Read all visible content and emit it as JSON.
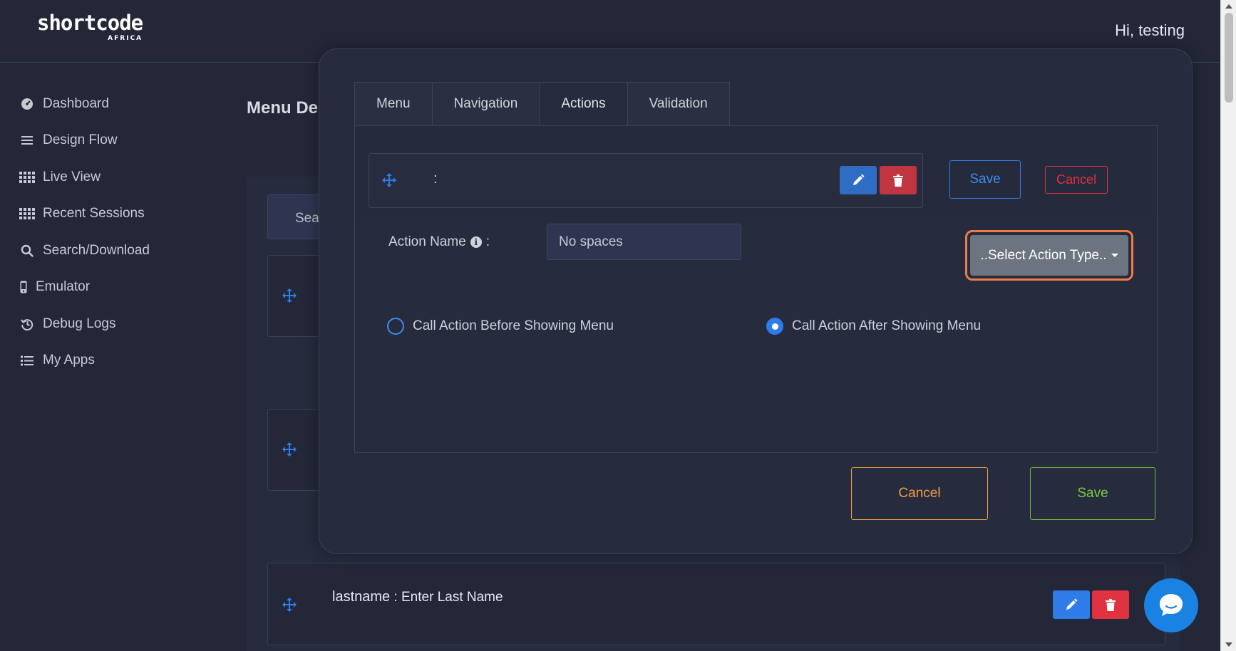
{
  "header": {
    "logo_main": "shortcode",
    "logo_sub": "AFRICA",
    "greeting": "Hi, testing"
  },
  "sidebar": {
    "items": [
      {
        "label": "Dashboard",
        "icon": "dashboard-icon"
      },
      {
        "label": "Design Flow",
        "icon": "menu-icon"
      },
      {
        "label": "Live View",
        "icon": "grid-icon"
      },
      {
        "label": "Recent Sessions",
        "icon": "grid-icon"
      },
      {
        "label": "Search/Download",
        "icon": "search-icon"
      },
      {
        "label": "Emulator",
        "icon": "phone-icon"
      },
      {
        "label": "Debug Logs",
        "icon": "history-icon"
      },
      {
        "label": "My Apps",
        "icon": "list-icon"
      }
    ]
  },
  "page": {
    "title": "Menu Des",
    "search_label": "Sear",
    "rows": [
      {
        "name": "lastname",
        "separator": " : ",
        "text": "Enter Last Name"
      }
    ]
  },
  "modal": {
    "tabs": [
      "Menu",
      "Navigation",
      "Actions",
      "Validation"
    ],
    "active_tab": "Actions",
    "action_card_text": ":",
    "save_label": "Save",
    "cancel_label": "Cancel",
    "action_name_label": "Action Name",
    "action_name_suffix": ":",
    "action_name_placeholder": "No spaces",
    "select_action_type": "..Select Action Type..",
    "radio_before": "Call Action Before Showing Menu",
    "radio_after": "Call Action After Showing Menu",
    "radio_selected": "after",
    "footer_cancel": "Cancel",
    "footer_save": "Save"
  },
  "colors": {
    "background": "#232738",
    "accent_blue": "#2f7ce8",
    "danger_red": "#e0323f",
    "warning_orange": "#f0a040",
    "success_green": "#7acc3f",
    "focus_ring": "#f07c45"
  }
}
